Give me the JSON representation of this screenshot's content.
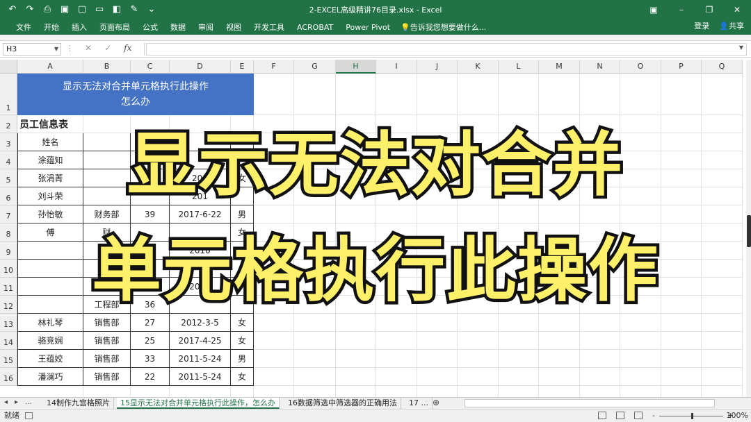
{
  "app": {
    "document_title": "2-EXCEL高级精讲76目录.xlsx - Excel"
  },
  "ribbon": {
    "tabs": [
      "文件",
      "开始",
      "插入",
      "页面布局",
      "公式",
      "数据",
      "审阅",
      "视图",
      "开发工具",
      "ACROBAT",
      "Power Pivot"
    ],
    "tell_me": "告诉我您想要做什么...",
    "login": "登录",
    "share": "共享"
  },
  "formula_bar": {
    "name_box": "H3",
    "fx_label": "fx",
    "formula": ""
  },
  "grid": {
    "columns": [
      "A",
      "B",
      "C",
      "D",
      "E",
      "F",
      "G",
      "H",
      "I",
      "J",
      "K",
      "L",
      "M",
      "N",
      "O",
      "P",
      "Q"
    ],
    "selected_column": "H",
    "rows": [
      "1",
      "2",
      "3",
      "4",
      "5",
      "6",
      "7",
      "8",
      "9",
      "10",
      "11",
      "12",
      "13",
      "14",
      "15",
      "16"
    ],
    "merged_title": "显示无法对合并单元格执行此操作\n怎么办",
    "table_title": "员工信息表",
    "header": {
      "name": "姓名"
    },
    "cells": [
      {
        "row": "4",
        "a": "涂蕴知",
        "b": "",
        "c": "",
        "d": "",
        "e": ""
      },
      {
        "row": "5",
        "a": "张涓菁",
        "b": "",
        "c": "",
        "d": "201",
        "e": "女"
      },
      {
        "row": "6",
        "a": "刘斗荣",
        "b": "",
        "c": "",
        "d": "201",
        "e": ""
      },
      {
        "row": "7",
        "a": "孙怡敏",
        "b": "财务部",
        "c": "39",
        "d": "2017-6-22",
        "e": "男"
      },
      {
        "row": "8",
        "a": "傅",
        "b": "财",
        "c": "",
        "d": "",
        "e": "女"
      },
      {
        "row": "9",
        "a": "",
        "b": "",
        "c": "28",
        "d": "2010",
        "e": ""
      },
      {
        "row": "10",
        "a": "",
        "b": "",
        "c": "",
        "d": "",
        "e": ""
      },
      {
        "row": "11",
        "a": "",
        "b": "",
        "c": "7",
        "d": "2011",
        "e": ""
      },
      {
        "row": "12",
        "a": "",
        "b": "工程部",
        "c": "36",
        "d": "",
        "e": ""
      },
      {
        "row": "13",
        "a": "林礼琴",
        "b": "销售部",
        "c": "27",
        "d": "2012-3-5",
        "e": "女"
      },
      {
        "row": "14",
        "a": "骆竞娴",
        "b": "销售部",
        "c": "25",
        "d": "2017-4-25",
        "e": "女"
      },
      {
        "row": "15",
        "a": "王蕴姣",
        "b": "销售部",
        "c": "33",
        "d": "2011-5-24",
        "e": "男"
      },
      {
        "row": "16",
        "a": "潘澜巧",
        "b": "销售部",
        "c": "22",
        "d": "2011-5-24",
        "e": "女"
      }
    ]
  },
  "overlay": {
    "line1": "显示无法对合并",
    "line2": "单元格执行此操作"
  },
  "sheet_tabs": {
    "nav": [
      "◂",
      "▸",
      "..."
    ],
    "tabs": [
      "14制作九宫格照片",
      "15显示无法对合并单元格执行此操作，怎么办",
      "16数据筛选中筛选器的正确用法",
      "17 ..."
    ],
    "active_index": 1,
    "add": "⊕"
  },
  "status": {
    "ready": "就绪",
    "zoom": "100%",
    "minus": "-",
    "plus": "+"
  },
  "colors": {
    "excel_green": "#217346",
    "merged_blue": "#4472c4",
    "overlay_yellow": "#fff06a"
  }
}
